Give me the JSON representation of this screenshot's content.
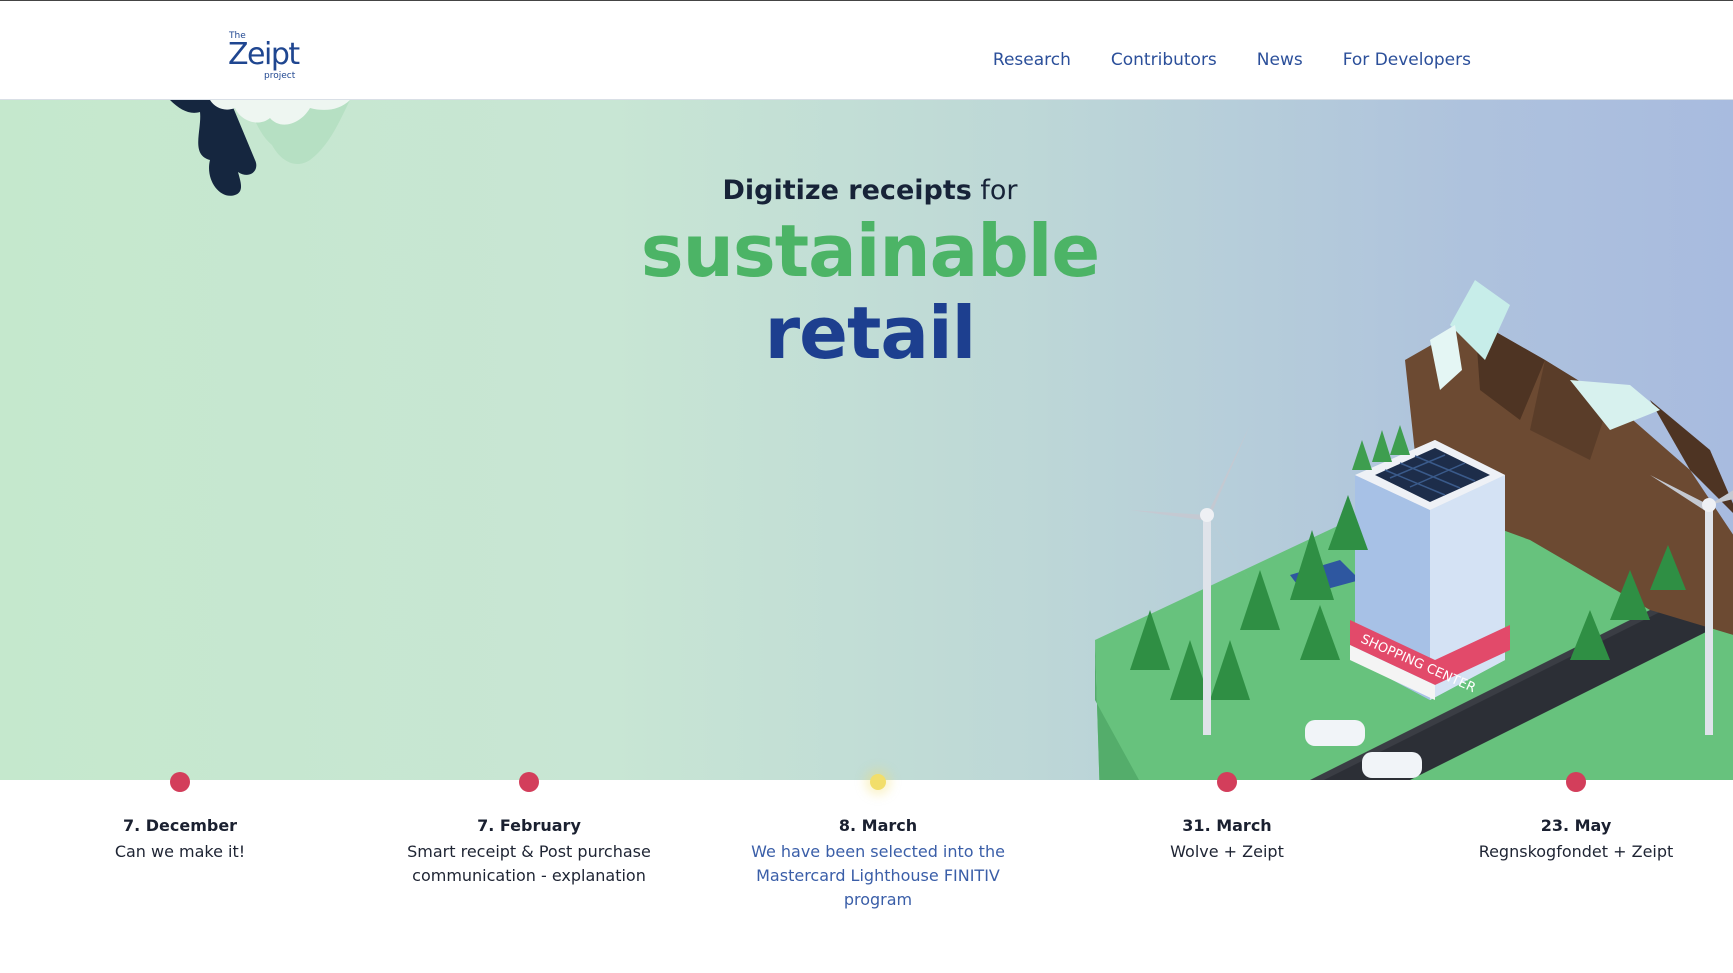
{
  "logo": {
    "the": "The",
    "word": "Zeipt",
    "project": "project"
  },
  "nav": {
    "items": [
      {
        "label": "Research"
      },
      {
        "label": "Contributors"
      },
      {
        "label": "News"
      },
      {
        "label": "For Developers"
      }
    ]
  },
  "hero": {
    "line1_bold": "Digitize receipts",
    "line1_light": "for",
    "line2": "sustainable",
    "line3": "retail",
    "store_sign": "SHOPPING CENTER"
  },
  "timeline": {
    "items": [
      {
        "date": "7. December",
        "title": "Can we make it!"
      },
      {
        "date": "7. February",
        "title": "Smart receipt & Post purchase communication - explanation"
      },
      {
        "date": "8. March",
        "title": "We have been selected into the Mastercard Lighthouse FINITIV program",
        "active": true
      },
      {
        "date": "31. March",
        "title": "Wolve + Zeipt"
      },
      {
        "date": "23. May",
        "title": "Regnskogfondet + Zeipt"
      }
    ]
  },
  "colors": {
    "accent_green": "#4cb466",
    "accent_blue": "#1d3f8f",
    "nav_text": "#2b4f9a",
    "timeline_dot": "#d33e5b",
    "timeline_active_dot": "#f2de6b"
  }
}
